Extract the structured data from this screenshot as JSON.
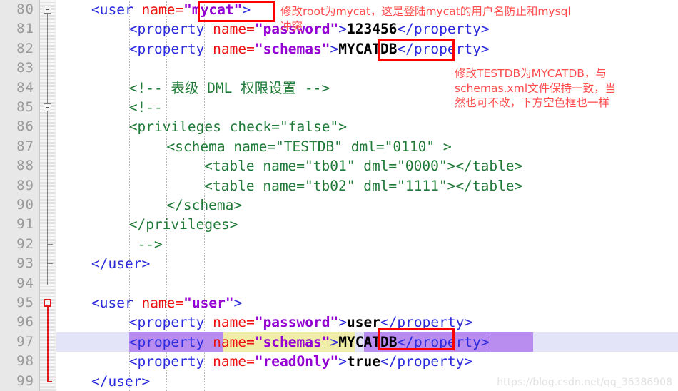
{
  "editor": {
    "first_line": 80,
    "last_line": 99,
    "line_numbers": [
      "80",
      "81",
      "82",
      "83",
      "84",
      "85",
      "86",
      "87",
      "88",
      "89",
      "90",
      "91",
      "92",
      "93",
      "94",
      "95",
      "96",
      "97",
      "98",
      "99"
    ],
    "colors": {
      "tag": "#2b2bdd",
      "attribute": "#ee1111",
      "attribute_value": "#9400d3",
      "text_content": "#000000",
      "comment": "#1f7a37",
      "gutter_background": "#e8e8e8",
      "line_number": "#9a9a9a",
      "current_line_highlight": "#e3e4f8",
      "selection": "#b98cf0",
      "match_highlight": "#f0eda8",
      "annotation_red": "#ff4b4b",
      "box_red": "#ff0000",
      "fold_marker_red": "#e01b1b"
    },
    "lines": [
      {
        "n": "80",
        "indent": 0,
        "segments": [
          {
            "text": "<user ",
            "cls": "t-tag"
          },
          {
            "text": "name=",
            "cls": "t-attr"
          },
          {
            "text": "\"mycat\"",
            "cls": "t-val"
          },
          {
            "text": ">",
            "cls": "t-tag"
          }
        ]
      },
      {
        "n": "81",
        "indent": 4,
        "segments": [
          {
            "text": "<property ",
            "cls": "t-tag"
          },
          {
            "text": "name=",
            "cls": "t-attr"
          },
          {
            "text": "\"password\"",
            "cls": "t-val"
          },
          {
            "text": ">",
            "cls": "t-tag"
          },
          {
            "text": "123456",
            "cls": "t-text"
          },
          {
            "text": "</property>",
            "cls": "t-tag"
          }
        ]
      },
      {
        "n": "82",
        "indent": 4,
        "segments": [
          {
            "text": "<property ",
            "cls": "t-tag"
          },
          {
            "text": "name=",
            "cls": "t-attr"
          },
          {
            "text": "\"schemas\"",
            "cls": "t-val"
          },
          {
            "text": ">",
            "cls": "t-tag"
          },
          {
            "text": "MYCATDB",
            "cls": "t-text"
          },
          {
            "text": "</property>",
            "cls": "t-tag"
          }
        ]
      },
      {
        "n": "83",
        "indent": 0,
        "segments": []
      },
      {
        "n": "84",
        "indent": 4,
        "segments": [
          {
            "text": "<!-- 表级 DML 权限设置 -->",
            "cls": "t-comment"
          }
        ]
      },
      {
        "n": "85",
        "indent": 4,
        "segments": [
          {
            "text": "<!--",
            "cls": "t-comment"
          }
        ]
      },
      {
        "n": "86",
        "indent": 4,
        "segments": [
          {
            "text": "<privileges check=\"false\">",
            "cls": "t-comment"
          }
        ]
      },
      {
        "n": "87",
        "indent": 8,
        "segments": [
          {
            "text": "<schema name=\"TESTDB\" dml=\"0110\" >",
            "cls": "t-comment"
          }
        ]
      },
      {
        "n": "88",
        "indent": 12,
        "segments": [
          {
            "text": "<table name=\"tb01\" dml=\"0000\"></table>",
            "cls": "t-comment"
          }
        ]
      },
      {
        "n": "89",
        "indent": 12,
        "segments": [
          {
            "text": "<table name=\"tb02\" dml=\"1111\"></table>",
            "cls": "t-comment"
          }
        ]
      },
      {
        "n": "90",
        "indent": 8,
        "segments": [
          {
            "text": "</schema>",
            "cls": "t-comment"
          }
        ]
      },
      {
        "n": "91",
        "indent": 4,
        "segments": [
          {
            "text": "</privileges>",
            "cls": "t-comment"
          }
        ]
      },
      {
        "n": "92",
        "indent": 4,
        "segments": [
          {
            "text": " -->",
            "cls": "t-comment"
          }
        ]
      },
      {
        "n": "93",
        "indent": 0,
        "segments": [
          {
            "text": "</user>",
            "cls": "t-tag"
          }
        ]
      },
      {
        "n": "94",
        "indent": 0,
        "segments": []
      },
      {
        "n": "95",
        "indent": 0,
        "segments": [
          {
            "text": "<user ",
            "cls": "t-tag"
          },
          {
            "text": "name=",
            "cls": "t-attr"
          },
          {
            "text": "\"user\"",
            "cls": "t-val"
          },
          {
            "text": ">",
            "cls": "t-tag"
          }
        ]
      },
      {
        "n": "96",
        "indent": 4,
        "segments": [
          {
            "text": "<property ",
            "cls": "t-tag"
          },
          {
            "text": "name=",
            "cls": "t-attr"
          },
          {
            "text": "\"password\"",
            "cls": "t-val"
          },
          {
            "text": ">",
            "cls": "t-tag"
          },
          {
            "text": "user",
            "cls": "t-text"
          },
          {
            "text": "</property>",
            "cls": "t-tag"
          }
        ]
      },
      {
        "n": "97",
        "indent": 4,
        "segments": [
          {
            "text": "<property ",
            "cls": "t-tag"
          },
          {
            "text": "name=",
            "cls": "t-attr"
          },
          {
            "text": "\"schemas\"",
            "cls": "t-val"
          },
          {
            "text": ">",
            "cls": "t-tag"
          },
          {
            "text": "MYCATDB",
            "cls": "t-text"
          },
          {
            "text": "</property>",
            "cls": "t-tag"
          }
        ]
      },
      {
        "n": "98",
        "indent": 4,
        "segments": [
          {
            "text": "<property ",
            "cls": "t-tag"
          },
          {
            "text": "name=",
            "cls": "t-attr"
          },
          {
            "text": "\"readOnly\"",
            "cls": "t-val"
          },
          {
            "text": ">",
            "cls": "t-tag"
          },
          {
            "text": "true",
            "cls": "t-text"
          },
          {
            "text": "</property>",
            "cls": "t-tag"
          }
        ]
      },
      {
        "n": "99",
        "indent": 0,
        "segments": [
          {
            "text": "</user>",
            "cls": "t-tag"
          }
        ]
      }
    ],
    "fold_markers": [
      {
        "line": "80",
        "type": "collapse-box",
        "color": "#777777"
      },
      {
        "line": "85",
        "type": "collapse-box",
        "color": "#777777"
      },
      {
        "line": "95",
        "type": "collapse-box",
        "color": "#e01b1b"
      }
    ],
    "current_line": "97",
    "selection": {
      "line": "97",
      "selected_text_left": "<property ",
      "selected_text_right": "MYCATDB</property>",
      "match_highlight_text": "name=\"schemas\""
    }
  },
  "annotations": {
    "note1": {
      "lines": [
        "修改root为mycat，这是登陆mycat的用户名防止和mysql",
        "冲突"
      ],
      "target": "\"mycat\""
    },
    "note2": {
      "lines": [
        "修改TESTDB为MYCATDB，与",
        "schemas.xml文件保持一致，当",
        "然也可不改，下方空色框也一样"
      ],
      "target": "MYCATDB"
    }
  },
  "red_boxes": [
    {
      "label": "mycat-value-box",
      "target": "\"mycat\""
    },
    {
      "label": "mycatdb-line82-box",
      "target": "MYCATDB"
    },
    {
      "label": "mycatdb-line97-box",
      "target": "MYCATDB"
    }
  ],
  "watermark": {
    "text": "https://blog.csdn.net/qq_36386908"
  }
}
